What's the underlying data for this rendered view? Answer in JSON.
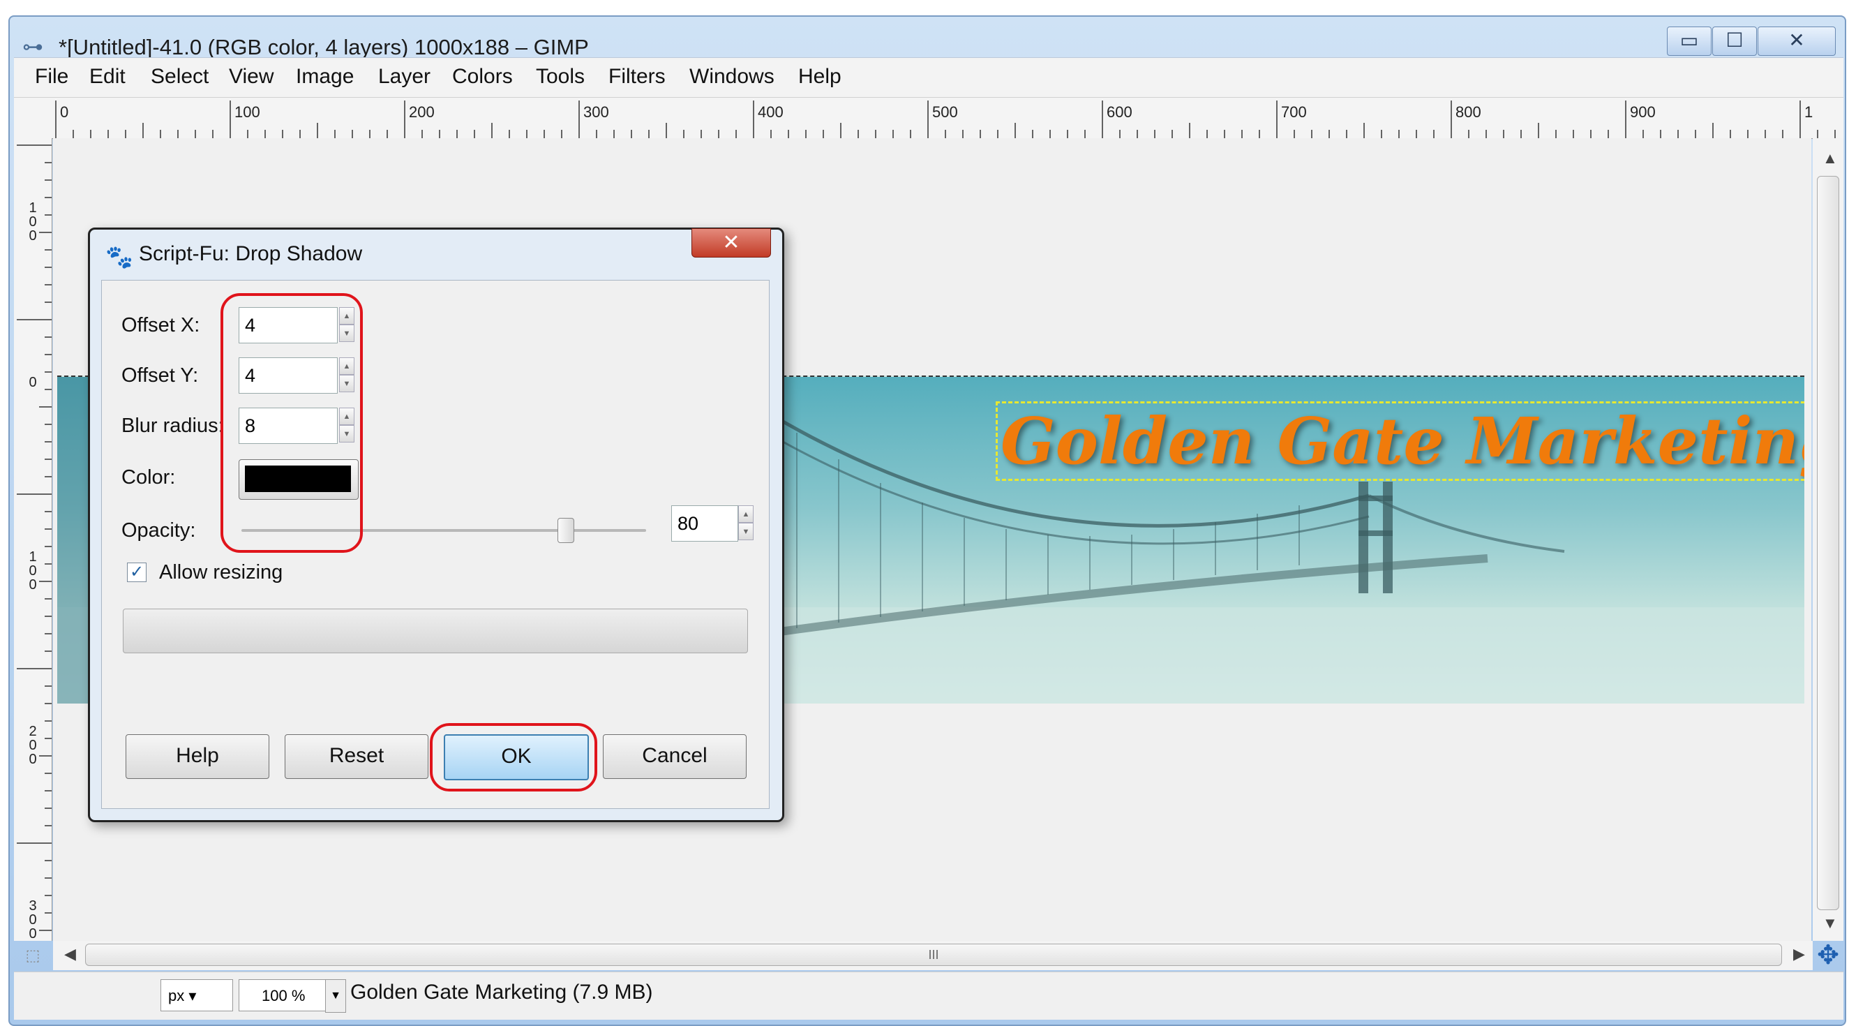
{
  "window": {
    "title": "*[Untitled]-41.0 (RGB color, 4 layers) 1000x188 – GIMP",
    "controls": {
      "minimize": "▭",
      "maximize": "☐",
      "close": "✕"
    }
  },
  "menubar": {
    "items": [
      {
        "label": "File"
      },
      {
        "label": "Edit"
      },
      {
        "label": "Select"
      },
      {
        "label": "View"
      },
      {
        "label": "Image"
      },
      {
        "label": "Layer"
      },
      {
        "label": "Colors"
      },
      {
        "label": "Tools"
      },
      {
        "label": "Filters"
      },
      {
        "label": "Windows"
      },
      {
        "label": "Help"
      }
    ]
  },
  "ruler_h": {
    "labels": [
      "0",
      "100",
      "200",
      "300",
      "400",
      "500",
      "600",
      "700",
      "800",
      "900",
      "1"
    ]
  },
  "ruler_v": {
    "labels": [
      "100",
      "0",
      "100",
      "200",
      "300"
    ]
  },
  "canvas": {
    "image_text": "Golden Gate Marketing"
  },
  "scrollbar": {
    "grip": "III"
  },
  "statusbar": {
    "unit": "px",
    "zoom": "100 %",
    "info": "Golden Gate Marketing (7.9 MB)"
  },
  "dialog": {
    "title": "Script-Fu: Drop Shadow",
    "close": "✕",
    "fields": {
      "offset_x": {
        "label": "Offset X:",
        "value": "4"
      },
      "offset_y": {
        "label": "Offset Y:",
        "value": "4"
      },
      "blur_radius": {
        "label": "Blur radius:",
        "value": "8"
      },
      "color": {
        "label": "Color:",
        "value": "#000000"
      },
      "opacity": {
        "label": "Opacity:",
        "value": "80"
      },
      "allow_resizing": {
        "label": "Allow resizing",
        "checked": true,
        "check_mark": "✓"
      }
    },
    "buttons": {
      "help": "Help",
      "reset": "Reset",
      "ok": "OK",
      "cancel": "Cancel"
    }
  },
  "colors": {
    "highlight_annotation": "#e0141b",
    "image_text": "#f07b0b",
    "ok_button": "#a7d4f4"
  },
  "icons": [
    "gimp-icon",
    "minimize-icon",
    "maximize-icon",
    "close-icon",
    "script-fu-icon",
    "navigate-icon",
    "quick-mask-icon"
  ]
}
